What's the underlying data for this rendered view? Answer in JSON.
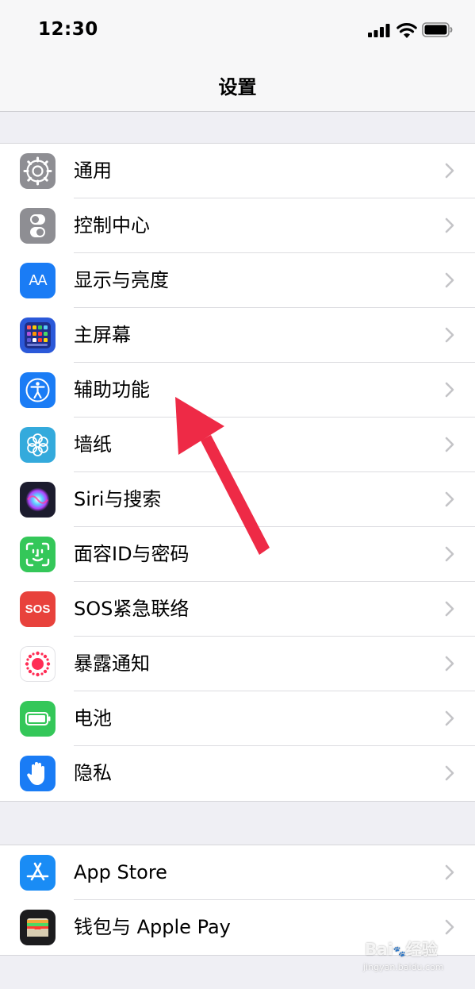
{
  "status_bar": {
    "time": "12:30"
  },
  "nav": {
    "title": "设置"
  },
  "settings_group_1": [
    {
      "label": "通用",
      "icon": "gear-icon",
      "color": "#8e8e93"
    },
    {
      "label": "控制中心",
      "icon": "toggles-icon",
      "color": "#8e8e93"
    },
    {
      "label": "显示与亮度",
      "icon": "text-size-icon",
      "icon_text": "AA",
      "color": "#1a7cf5"
    },
    {
      "label": "主屏幕",
      "icon": "app-grid-icon",
      "color": "#2b59d9"
    },
    {
      "label": "辅助功能",
      "icon": "accessibility-icon",
      "color": "#1a7cf5"
    },
    {
      "label": "墙纸",
      "icon": "flower-icon",
      "color": "#34aadc"
    },
    {
      "label": "Siri与搜索",
      "icon": "siri-icon",
      "color": "#1c1c2e"
    },
    {
      "label": "面容ID与密码",
      "icon": "face-id-icon",
      "color": "#34c759"
    },
    {
      "label": "SOS紧急联络",
      "icon": "sos-icon",
      "icon_text": "SOS",
      "color": "#e8423c"
    },
    {
      "label": "暴露通知",
      "icon": "exposure-icon",
      "color": "#ffffff"
    },
    {
      "label": "电池",
      "icon": "battery-icon",
      "color": "#34c759"
    },
    {
      "label": "隐私",
      "icon": "hand-icon",
      "color": "#1a7cf5"
    }
  ],
  "settings_group_2": [
    {
      "label": "App Store",
      "icon": "app-store-icon",
      "color": "#1a8cf5"
    },
    {
      "label": "钱包与 Apple Pay",
      "icon": "wallet-icon",
      "color": "#1c1c1e"
    }
  ],
  "annotation": {
    "arrow_color": "#ee2a46"
  },
  "watermark": {
    "brand": "Bai",
    "brand2": "经验",
    "url": "jingyan.baidu.com"
  }
}
